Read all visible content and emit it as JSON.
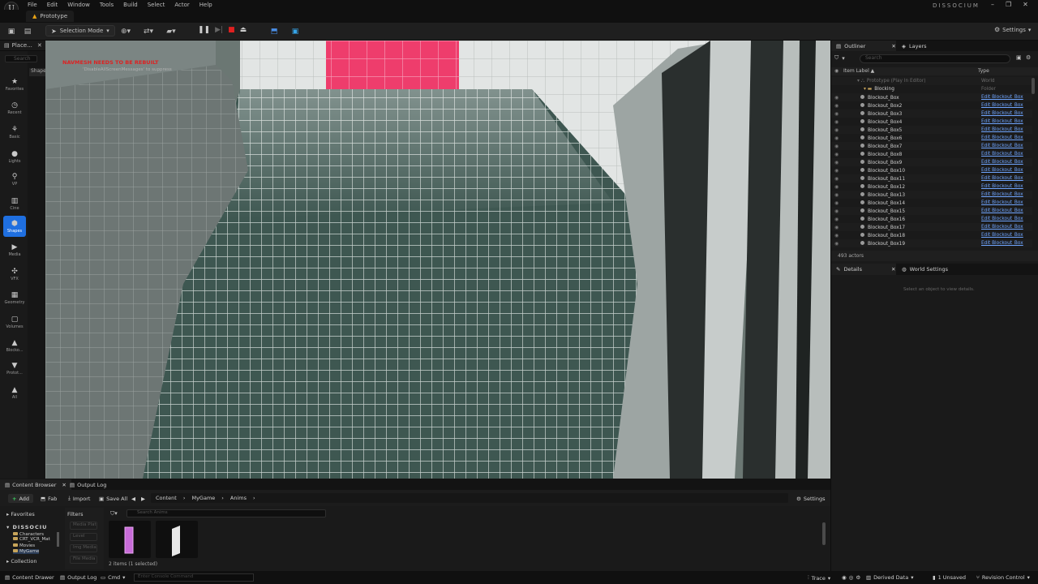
{
  "menu": {
    "items": [
      "File",
      "Edit",
      "Window",
      "Tools",
      "Build",
      "Select",
      "Actor",
      "Help"
    ],
    "app_title": "DISSOCIUM",
    "logo_text": "U"
  },
  "level_tab": "Prototype",
  "toolbar": {
    "selection_mode": "Selection Mode",
    "settings": "Settings"
  },
  "place_actors": {
    "title": "Place...",
    "search_placeholder": "Search",
    "shapes_tab": "Shape",
    "categories": [
      {
        "label": "Favorites",
        "icon": "star-icon"
      },
      {
        "label": "Recent",
        "icon": "clock-icon"
      },
      {
        "label": "Basic",
        "icon": "basic-icon"
      },
      {
        "label": "Lights",
        "icon": "light-icon"
      },
      {
        "label": "VP",
        "icon": "vp-icon"
      },
      {
        "label": "Cine",
        "icon": "cine-icon"
      },
      {
        "label": "Shapes",
        "icon": "shapes-icon"
      },
      {
        "label": "Media",
        "icon": "media-icon"
      },
      {
        "label": "VFX",
        "icon": "vfx-icon"
      },
      {
        "label": "Geometry",
        "icon": "geometry-icon"
      },
      {
        "label": "Volumes",
        "icon": "volumes-icon"
      },
      {
        "label": "Blocko...",
        "icon": "blockout-icon"
      },
      {
        "label": "Protot...",
        "icon": "prototype-icon"
      },
      {
        "label": "All",
        "icon": "all-icon"
      }
    ],
    "active_category": "Shapes"
  },
  "viewport": {
    "warning": "NAVMESH NEEDS TO BE REBUILT",
    "hint": "'DisableAllScreenMessages' to suppress"
  },
  "outliner": {
    "tab_outliner": "Outliner",
    "tab_layers": "Layers",
    "search_placeholder": "Search",
    "col_label": "Item Label ▲",
    "col_type": "Type",
    "root": {
      "name": "Prototype (Play In Editor)",
      "type": "World"
    },
    "folder": {
      "name": "Blocking",
      "type": "Folder"
    },
    "rows": [
      {
        "name": "Blockout_Box",
        "type": "Edit Blockout_Box"
      },
      {
        "name": "Blockout_Box2",
        "type": "Edit Blockout_Box"
      },
      {
        "name": "Blockout_Box3",
        "type": "Edit Blockout_Box"
      },
      {
        "name": "Blockout_Box4",
        "type": "Edit Blockout_Box"
      },
      {
        "name": "Blockout_Box5",
        "type": "Edit Blockout_Box"
      },
      {
        "name": "Blockout_Box6",
        "type": "Edit Blockout_Box"
      },
      {
        "name": "Blockout_Box7",
        "type": "Edit Blockout_Box"
      },
      {
        "name": "Blockout_Box8",
        "type": "Edit Blockout_Box"
      },
      {
        "name": "Blockout_Box9",
        "type": "Edit Blockout_Box"
      },
      {
        "name": "Blockout_Box10",
        "type": "Edit Blockout_Box"
      },
      {
        "name": "Blockout_Box11",
        "type": "Edit Blockout_Box"
      },
      {
        "name": "Blockout_Box12",
        "type": "Edit Blockout_Box"
      },
      {
        "name": "Blockout_Box13",
        "type": "Edit Blockout_Box"
      },
      {
        "name": "Blockout_Box14",
        "type": "Edit Blockout_Box"
      },
      {
        "name": "Blockout_Box15",
        "type": "Edit Blockout_Box"
      },
      {
        "name": "Blockout_Box16",
        "type": "Edit Blockout_Box"
      },
      {
        "name": "Blockout_Box17",
        "type": "Edit Blockout_Box"
      },
      {
        "name": "Blockout_Box18",
        "type": "Edit Blockout_Box"
      },
      {
        "name": "Blockout_Box19",
        "type": "Edit Blockout_Box"
      }
    ],
    "actor_count": "493 actors"
  },
  "details": {
    "tab_details": "Details",
    "tab_world": "World Settings",
    "empty": "Select an object to view details."
  },
  "content_browser": {
    "tab_cb": "Content Browser",
    "tab_log": "Output Log",
    "add": "Add",
    "fab": "Fab",
    "import": "Import",
    "save_all": "Save All",
    "path": [
      "Content",
      "MyGame",
      "Anims"
    ],
    "settings": "Settings",
    "favorites": "Favorites",
    "project": "DISSOCIU",
    "folders": [
      "Characters",
      "CRT_VCR_Mat",
      "Movies",
      "MyGame"
    ],
    "collections": "Collection",
    "filters": "Filters",
    "filter_items": [
      "Media Plat",
      "Level",
      "Img Media",
      "File Media"
    ],
    "search_placeholder": "Search Anims",
    "items_count": "2 items (1 selected)"
  },
  "statusbar": {
    "content_drawer": "Content Drawer",
    "output_log": "Output Log",
    "cmd": "Cmd",
    "console_placeholder": "Enter Console Command",
    "trace": "Trace",
    "derived_data": "Derived Data",
    "unsaved": "1 Unsaved",
    "revision": "Revision Control"
  }
}
